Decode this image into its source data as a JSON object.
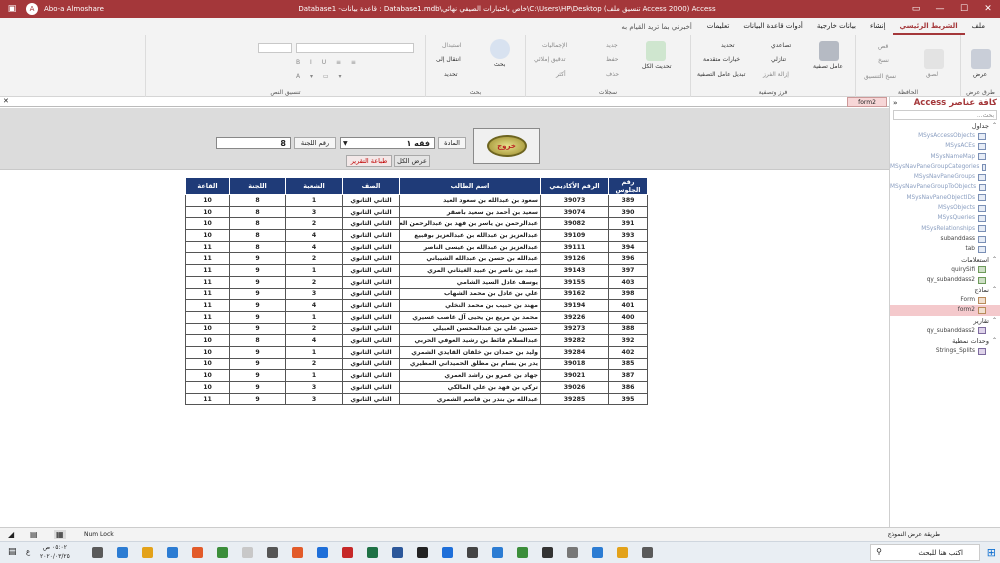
{
  "window": {
    "title": "Access  (Access 2000 تنسيق ملف) C:\\Users\\HP\\Desktop\\خاص باختبارات الصيفي نهائي\\Database1.mdb : قاعدة بيانات- Database1",
    "user": "Abo-a Almoshare",
    "avatar_initial": "A",
    "btn_min": "—",
    "btn_max": "☐",
    "btn_close": "✕"
  },
  "menu": {
    "tabs": [
      "ملف",
      "الشريط الرئيسي",
      "إنشاء",
      "بيانات خارجية",
      "أدوات قاعدة البيانات",
      "تعليمات"
    ],
    "active_tab": "الشريط الرئيسي",
    "tell_me": "أخبرني بما تريد القيام به"
  },
  "ribbon": {
    "groups": {
      "views": "طرق عرض",
      "clipboard": "الحافظة",
      "sort_filter": "فرز وتصفية",
      "records": "سجلات",
      "find": "بحث",
      "text_format": "تنسيق النص"
    },
    "view": "عرض",
    "cut": "قص",
    "copy": "نسخ",
    "paste": "لصق",
    "format_painter": "نسخ التنسيق",
    "filter": "عامل تصفية",
    "ascending": "تصاعدي",
    "descending": "تنازلي",
    "remove_sort": "إزالة الفرز",
    "selection": "تحديد",
    "advanced": "خيارات متقدمة",
    "toggle_filter": "تبديل عامل التصفية",
    "refresh_all": "تحديث الكل",
    "new": "جديد",
    "save": "حفظ",
    "delete": "حذف",
    "totals": "الإجماليات",
    "spelling": "تدقيق إملائي",
    "more": "أكثر",
    "find": "بحث",
    "replace": "استبدال",
    "goto": "انتقال إلى",
    "select": "تحديد"
  },
  "nav": {
    "title": "كافة عناصر Access",
    "search_placeholder": "بحث...",
    "sections": [
      {
        "name": "جداول",
        "items": [
          {
            "label": "MSysAccessObjects",
            "kind": "table",
            "dim": true
          },
          {
            "label": "MSysACEs",
            "kind": "table",
            "dim": true
          },
          {
            "label": "MSysNameMap",
            "kind": "table",
            "dim": true
          },
          {
            "label": "MSysNavPaneGroupCategories",
            "kind": "table",
            "dim": true
          },
          {
            "label": "MSysNavPaneGroups",
            "kind": "table",
            "dim": true
          },
          {
            "label": "MSysNavPaneGroupToObjects",
            "kind": "table",
            "dim": true
          },
          {
            "label": "MSysNavPaneObjectIDs",
            "kind": "table",
            "dim": true
          },
          {
            "label": "MSysObjects",
            "kind": "table",
            "dim": true
          },
          {
            "label": "MSysQueries",
            "kind": "table",
            "dim": true
          },
          {
            "label": "MSysRelationships",
            "kind": "table",
            "dim": true
          },
          {
            "label": "subanddass",
            "kind": "table",
            "dim": false
          },
          {
            "label": "tab",
            "kind": "table",
            "dim": false
          }
        ]
      },
      {
        "name": "استعلامات",
        "items": [
          {
            "label": "quirySifi",
            "kind": "query",
            "dim": false
          },
          {
            "label": "qy_subanddass2",
            "kind": "query",
            "dim": false
          }
        ]
      },
      {
        "name": "نماذج",
        "items": [
          {
            "label": "Form",
            "kind": "form",
            "dim": false
          },
          {
            "label": "form2",
            "kind": "form",
            "dim": false,
            "selected": true
          }
        ]
      },
      {
        "name": "تقارير",
        "items": [
          {
            "label": "qy_subanddass2",
            "kind": "report",
            "dim": false
          }
        ]
      },
      {
        "name": "وحدات نمطية",
        "items": [
          {
            "label": "Strings_Splits",
            "kind": "module",
            "dim": false
          }
        ]
      }
    ]
  },
  "doc_tab": "form2",
  "form": {
    "subject_label": "المادة",
    "subject_value": "فقه ١",
    "committee_label": "رقم اللجنة",
    "committee_value": "8",
    "show_all": "عرض الكل",
    "print_report": "طباعة التقرير",
    "exit": "خروج"
  },
  "table": {
    "columns": [
      "رقم الجلوس",
      "الرقم الأكاديمي",
      "اسم الطالب",
      "الصف",
      "الشعبة",
      "اللجنة",
      "القاعة"
    ],
    "rows": [
      [
        "389",
        "39073",
        "سعود بن عبدالله بن سعود العيد",
        "الثاني الثانوي",
        "1",
        "8",
        "10"
      ],
      [
        "390",
        "39074",
        "سعيد بن أحمد بن سعيد باصقر",
        "الثاني الثانوي",
        "3",
        "8",
        "10"
      ],
      [
        "391",
        "39082",
        "عبدالرحمن بن ياسر بن فهد بن عبدالرحمن العثيان",
        "الثاني الثانوي",
        "2",
        "8",
        "10"
      ],
      [
        "393",
        "39109",
        "عبدالعزيز بن عبدالله بن عبدالعزيز بوقبيع",
        "الثاني الثانوي",
        "4",
        "8",
        "10"
      ],
      [
        "394",
        "39111",
        "عبدالعزيز بن عبدالله بن عيسى الناصر",
        "الثاني الثانوي",
        "4",
        "8",
        "11"
      ],
      [
        "396",
        "39126",
        "عبدالله بن حسن بن عبدالله الشيباني",
        "الثاني الثانوي",
        "2",
        "9",
        "11"
      ],
      [
        "397",
        "39143",
        "عبيد بن ناصر بن عبيد الغيثاني المري",
        "الثاني الثانوي",
        "1",
        "9",
        "11"
      ],
      [
        "403",
        "39155",
        "يوسف عادل السيد الشامي",
        "الثاني الثانوي",
        "2",
        "9",
        "11"
      ],
      [
        "398",
        "39162",
        "علي بن عادل بن محمد الشهاب",
        "الثاني الثانوي",
        "3",
        "9",
        "11"
      ],
      [
        "401",
        "39194",
        "مهند بن حبيب بن محمد النخلي",
        "الثاني الثانوي",
        "4",
        "9",
        "11"
      ],
      [
        "400",
        "39226",
        "محمد بن مريع بن يحيى آل غاصب عسيري",
        "الثاني الثانوي",
        "1",
        "9",
        "11"
      ],
      [
        "388",
        "39273",
        "حسين علي بن عبدالمحسن العبيلي",
        "الثاني الثانوي",
        "2",
        "9",
        "10"
      ],
      [
        "392",
        "39282",
        "عبدالسلام قائط بن رشيد العوفي الحربي",
        "الثاني الثانوي",
        "4",
        "8",
        "10"
      ],
      [
        "402",
        "39284",
        "وليد بن حمدان بن خلفان القايدي الشمري",
        "الثاني الثانوي",
        "1",
        "9",
        "10"
      ],
      [
        "385",
        "39018",
        "يدر بن بسام بن مطلق الحميداني المطيري",
        "الثاني الثانوي",
        "2",
        "9",
        "10"
      ],
      [
        "387",
        "39021",
        "جهاد بن عمرو بن راشد العمري",
        "الثاني الثانوي",
        "1",
        "9",
        "10"
      ],
      [
        "386",
        "39026",
        "تركي بن فهد بن علي المالكي",
        "الثاني الثانوي",
        "3",
        "9",
        "10"
      ],
      [
        "395",
        "39285",
        "عبدالله بن بندر بن قاسم الشمري",
        "الثاني الثانوي",
        "3",
        "9",
        "11"
      ]
    ]
  },
  "status": {
    "view_name": "طريقة عرض النموذج",
    "num_lock": "Num Lock"
  },
  "taskbar": {
    "search": "اكتب هنا للبحث",
    "time": "٠٥:٠٢ ص",
    "date": "٢٠٢٠/٠٣/٢٥",
    "lang": "ع"
  },
  "colors": {
    "accent": "#a4373a",
    "header_blue": "#1f3b78",
    "form_gray": "#dcdcdc"
  }
}
